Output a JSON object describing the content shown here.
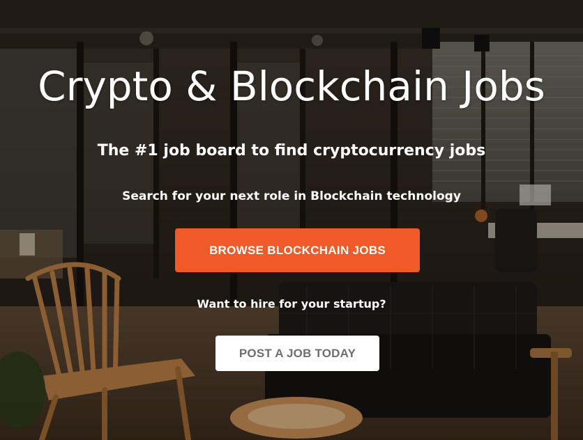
{
  "hero": {
    "title": "Crypto & Blockchain Jobs",
    "subtitle": "The #1 job board to find cryptocurrency jobs",
    "tagline": "Search for your next role in Blockchain technology",
    "browse_button_label": "BROWSE BLOCKCHAIN JOBS",
    "hire_prompt": "Want to hire for your startup?",
    "post_button_label": "POST A JOB TODAY"
  },
  "colors": {
    "accent": "#f05a28",
    "text_on_dark": "#ffffff",
    "secondary_button_bg": "#ffffff",
    "secondary_button_text": "#6e6e6e"
  }
}
